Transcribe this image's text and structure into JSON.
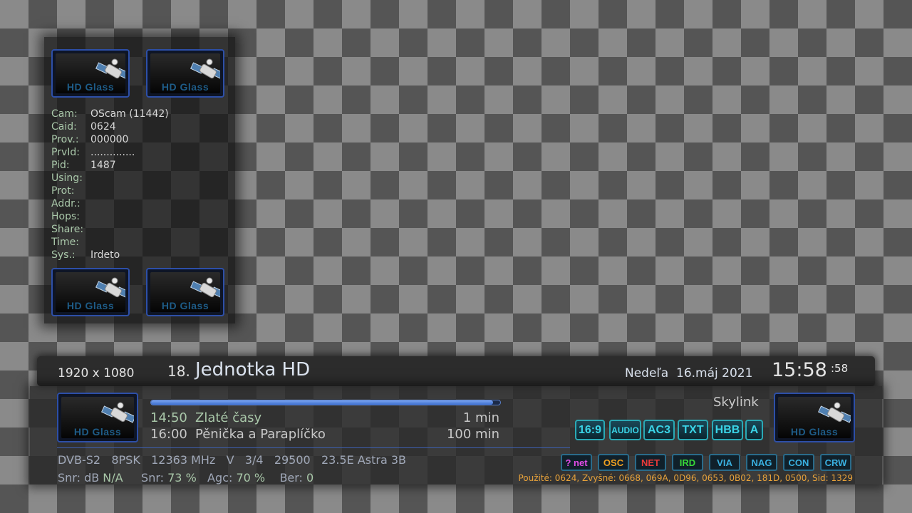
{
  "ecm": {
    "logo_text": "HD Glass",
    "rows": [
      {
        "label": "Cam:",
        "value": "OScam (11442)"
      },
      {
        "label": "Caid:",
        "value": "0624"
      },
      {
        "label": "Prov.:",
        "value": "000000"
      },
      {
        "label": "PrvId:",
        "value": ".............."
      },
      {
        "label": "Pid:",
        "value": "1487"
      },
      {
        "label": "Using:",
        "value": ""
      },
      {
        "label": "Prot:",
        "value": ""
      },
      {
        "label": "Addr.:",
        "value": ""
      },
      {
        "label": "Hops:",
        "value": ""
      },
      {
        "label": "Share:",
        "value": ""
      },
      {
        "label": "Time:",
        "value": ""
      },
      {
        "label": "Sys.:",
        "value": "Irdeto"
      }
    ]
  },
  "header": {
    "resolution": "1920 x 1080",
    "channel_number": "18.",
    "channel_name": "Jednotka HD",
    "date": "Nedeľa  16.máj 2021",
    "time": "15:58",
    "seconds": ":58"
  },
  "epg": {
    "progress": 0.98,
    "now": {
      "time": "14:50",
      "title": "Zlaté časy",
      "remaining": "1 min"
    },
    "next": {
      "time": "16:00",
      "title": "Pěnička a Paraplíčko",
      "duration": "100 min"
    }
  },
  "provider": "Skylink",
  "badges": [
    "16:9",
    "AUDIO",
    "AC3",
    "TXT",
    "HBB",
    "A"
  ],
  "tuner": {
    "system": "DVB-S2",
    "modulation": "8PSK",
    "frequency": "12363 MHz",
    "polarization": "V",
    "fec": "3/4",
    "symbol_rate": "29500",
    "satellite": "23.5E Astra 3B"
  },
  "signal": {
    "snr_db_label": "Snr: dB",
    "snr_db_value": "N/A",
    "snr_label": "Snr:",
    "snr_value": "73 %",
    "agc_label": "Agc:",
    "agc_value": "70 %",
    "ber_label": "Ber:",
    "ber_value": "0"
  },
  "cams": [
    {
      "label": "? net",
      "color": "#e24ce8"
    },
    {
      "label": "OSC",
      "color": "#f0a020"
    },
    {
      "label": "NET",
      "color": "#e83a3a"
    },
    {
      "label": "IRD",
      "color": "#38d838"
    },
    {
      "label": "VIA",
      "color": "#3ab0e0"
    },
    {
      "label": "NAG",
      "color": "#3ab0e0"
    },
    {
      "label": "CON",
      "color": "#3ab0e0"
    },
    {
      "label": "CRW",
      "color": "#3ab0e0"
    }
  ],
  "caids_line": "Použité: 0624, Zvyšné: 0668, 069A, 0D96, 0653, 0B02, 181D, 0500, Sid: 1329",
  "colors": {
    "label_green": "#a9c7a9",
    "epg_text": "#a9c7a9",
    "badge_cyan": "#3ad3e6",
    "caids_orange": "#e8a23a",
    "progress_blue": "#3d6fcf"
  }
}
